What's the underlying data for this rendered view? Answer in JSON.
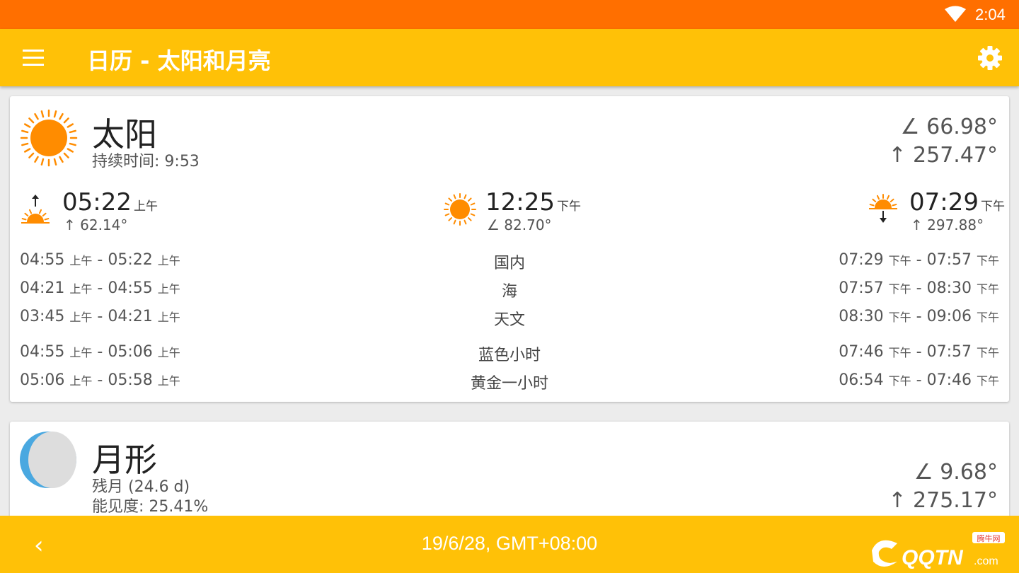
{
  "status_bar": {
    "time": "2:04"
  },
  "app_bar": {
    "title": "日历 - 太阳和月亮"
  },
  "sun": {
    "title": "太阳",
    "duration": "持续时间: 9:53",
    "elevation": "∠ 66.98°",
    "azimuth": "↑ 257.47°",
    "sunrise": {
      "time": "05:22",
      "ampm": "上午",
      "deg": "↑ 62.14°"
    },
    "noon": {
      "time": "12:25",
      "ampm": "下午",
      "deg": "∠ 82.70°"
    },
    "sunset": {
      "time": "07:29",
      "ampm": "下午",
      "deg": "↑ 297.88°"
    },
    "twilight_rows": [
      {
        "label": "国内",
        "m_start": "04:55",
        "m_start_ap": "上午",
        "m_end": "05:22",
        "m_end_ap": "上午",
        "e_start": "07:29",
        "e_start_ap": "下午",
        "e_end": "07:57",
        "e_end_ap": "下午"
      },
      {
        "label": "海",
        "m_start": "04:21",
        "m_start_ap": "上午",
        "m_end": "04:55",
        "m_end_ap": "上午",
        "e_start": "07:57",
        "e_start_ap": "下午",
        "e_end": "08:30",
        "e_end_ap": "下午"
      },
      {
        "label": "天文",
        "m_start": "03:45",
        "m_start_ap": "上午",
        "m_end": "04:21",
        "m_end_ap": "上午",
        "e_start": "08:30",
        "e_start_ap": "下午",
        "e_end": "09:06",
        "e_end_ap": "下午"
      },
      {
        "label": "蓝色小时",
        "m_start": "04:55",
        "m_start_ap": "上午",
        "m_end": "05:06",
        "m_end_ap": "上午",
        "e_start": "07:46",
        "e_start_ap": "下午",
        "e_end": "07:57",
        "e_end_ap": "下午"
      },
      {
        "label": "黄金一小时",
        "m_start": "05:06",
        "m_start_ap": "上午",
        "m_end": "05:58",
        "m_end_ap": "上午",
        "e_start": "06:54",
        "e_start_ap": "下午",
        "e_end": "07:46",
        "e_end_ap": "下午"
      }
    ]
  },
  "moon": {
    "title": "月形",
    "phase": "残月 (24.6 d)",
    "visibility": "能见度: 25.41%",
    "elevation": "∠ 9.68°",
    "azimuth": "↑ 275.17°"
  },
  "bottom_bar": {
    "back": "‹",
    "date": "19/6/28, GMT+08:00"
  },
  "colors": {
    "status_bar": "#ff6f00",
    "app_bar": "#ffc107",
    "sun": "#ff8c00",
    "moon_shadow": "#dddddd",
    "moon_lit": "#4aa8e0"
  },
  "icons": [
    "wifi-icon",
    "menu-icon",
    "gear-icon",
    "sun-icon",
    "sunrise-icon",
    "noon-sun-icon",
    "sunset-icon",
    "moon-phase-icon",
    "back-icon"
  ],
  "watermark": {
    "text": "QQTN.com",
    "tag": "腾牛网"
  }
}
